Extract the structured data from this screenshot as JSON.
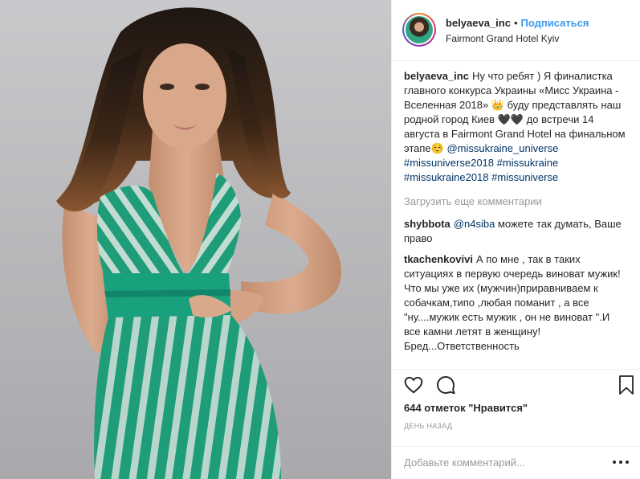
{
  "post": {
    "photo_alt": "",
    "header": {
      "username": "belyaeva_inc",
      "separator": "•",
      "follow_label": "Подписаться",
      "location": "Fairmont Grand Hotel Kyiv"
    },
    "caption": {
      "username": "belyaeva_inc",
      "text": "Ну что ребят ) Я финалистка главного конкурса Украины «Мисс Украина - Вселенная 2018» 👑 буду представлять наш родной город Киев 🖤🖤 до встречи 14 августа в Fairmont Grand Hotel на финальном этапе☺️",
      "hashtags": [
        "@missukraine_universe",
        "#missuniverse2018",
        "#missukraine",
        "#missukraine2018",
        "#missuniverse"
      ]
    },
    "load_more_label": "Загрузить еще комментарии",
    "comments": [
      {
        "username": "shybbota",
        "mention": "@n4siba",
        "text": "можете так думать, Ваше право"
      },
      {
        "username": "tkachenkovivi",
        "text": "А по мне , так в таких ситуациях в первую очередь виноват мужик!Что мы уже их (мужчин)приравниваем к собачкам,типо ,любая поманит , а все \"ну....мужик есть мужик , он не виноват \".И все камни летят в женщину!Бред...Ответственность"
      }
    ],
    "actions": {
      "like_icon": "heart-outline-icon",
      "comment_icon": "speech-bubble-icon",
      "save_icon": "bookmark-icon"
    },
    "likes_text": "644 отметок \"Нравится\"",
    "time_text": "ДЕНЬ НАЗАД",
    "add_comment_placeholder": "Добавьте комментарий...",
    "more_icon": "ellipsis-icon"
  },
  "colors": {
    "link": "#3897f0",
    "hashtag": "#003569",
    "muted": "#999999",
    "border": "#efefef",
    "text": "#262626"
  }
}
